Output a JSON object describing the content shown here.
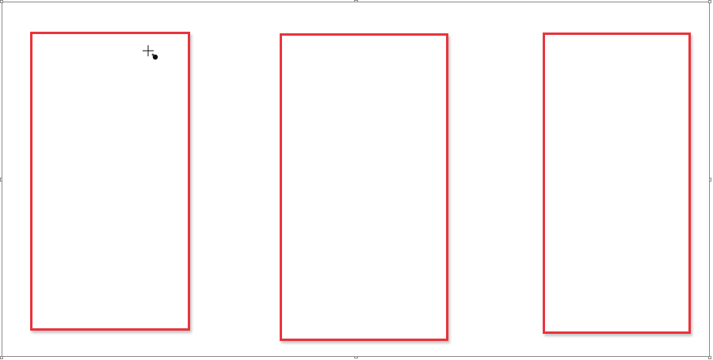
{
  "canvas": {
    "background_color": "#ffffff",
    "frame_color": "#8a8a8a"
  },
  "shapes": [
    {
      "name": "rectangle-1",
      "type": "rectangle",
      "stroke_color": "#e8343c",
      "fill_color": "#ffffff"
    },
    {
      "name": "rectangle-2",
      "type": "rectangle",
      "stroke_color": "#e8343c",
      "fill_color": "#ffffff"
    },
    {
      "name": "rectangle-3",
      "type": "rectangle",
      "stroke_color": "#e8343c",
      "fill_color": "#ffffff"
    }
  ],
  "cursor": {
    "icon": "crosshair-move-cursor-icon"
  }
}
